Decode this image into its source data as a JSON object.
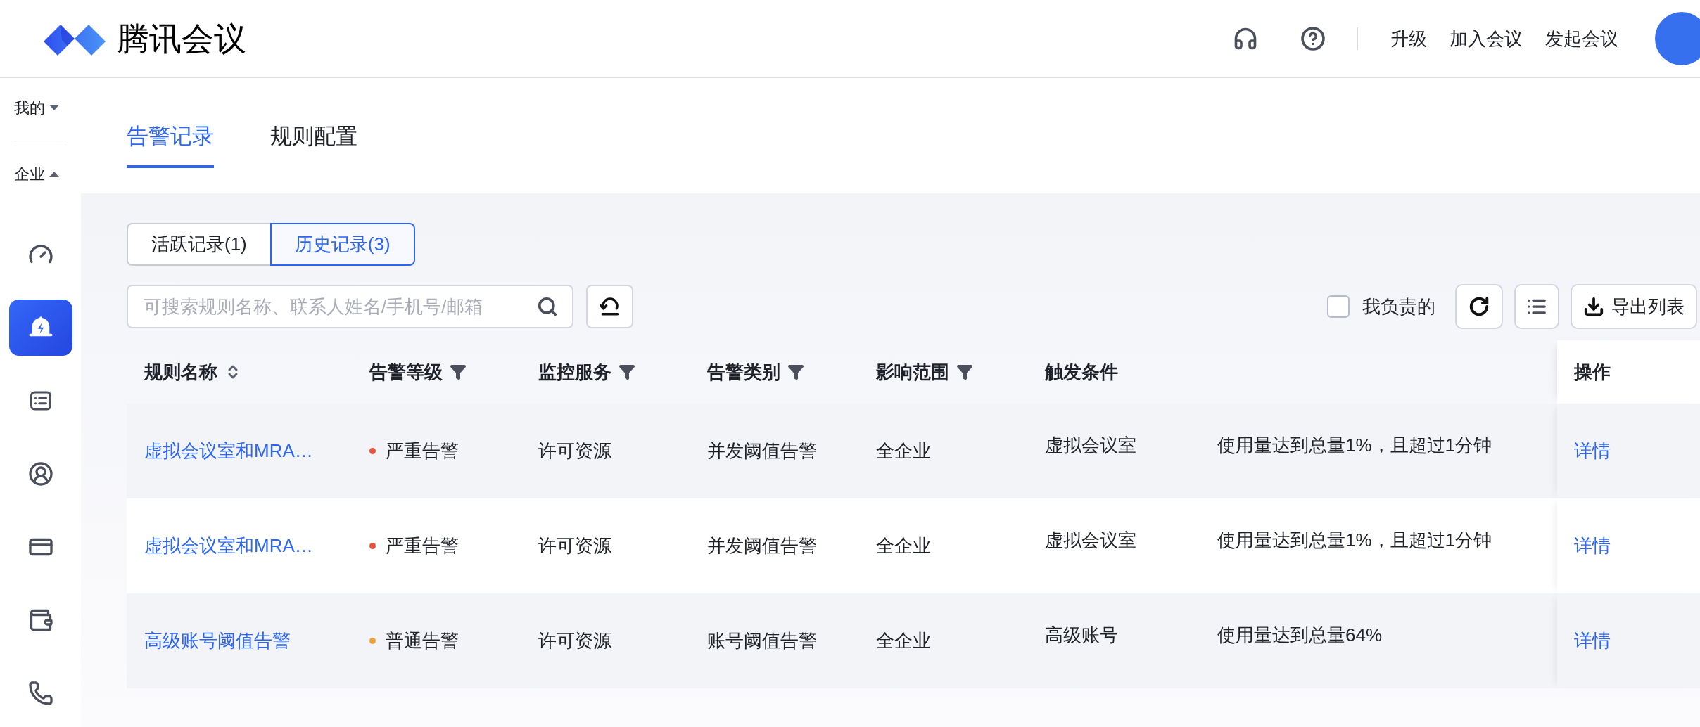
{
  "header": {
    "app_name": "腾讯会议",
    "actions": [
      "升级",
      "加入会议",
      "发起会议"
    ]
  },
  "sidebar": {
    "sections": [
      {
        "label": "我的",
        "expanded": false
      },
      {
        "label": "企业",
        "expanded": true
      }
    ],
    "nav": [
      {
        "kind": "gauge",
        "selected": false
      },
      {
        "kind": "alert",
        "selected": true
      },
      {
        "kind": "list",
        "selected": false
      },
      {
        "kind": "user",
        "selected": false
      },
      {
        "kind": "card",
        "selected": false
      },
      {
        "kind": "wallet",
        "selected": false
      },
      {
        "kind": "phone",
        "selected": false
      }
    ]
  },
  "tabs": [
    {
      "label": "告警记录",
      "selected": true
    },
    {
      "label": "规则配置",
      "selected": false
    }
  ],
  "segments": [
    {
      "label": "活跃记录(1)",
      "selected": false
    },
    {
      "label": "历史记录(3)",
      "selected": true
    }
  ],
  "search": {
    "placeholder": "可搜索规则名称、联系人姓名/手机号/邮箱"
  },
  "mine_filter": {
    "label": "我负责的",
    "checked": false
  },
  "export_button": "导出列表",
  "table": {
    "columns": [
      {
        "label": "规则名称",
        "kind": "sort"
      },
      {
        "label": "告警等级",
        "kind": "filter"
      },
      {
        "label": "监控服务",
        "kind": "filter"
      },
      {
        "label": "告警类别",
        "kind": "filter"
      },
      {
        "label": "影响范围",
        "kind": "filter"
      },
      {
        "label": "触发条件",
        "kind": "plain"
      },
      {
        "label": "操作",
        "kind": "plain"
      }
    ],
    "rows": [
      {
        "name": "虚拟会议室和MRA…",
        "level": {
          "label": "严重告警",
          "color": "#e8533f"
        },
        "service": "许可资源",
        "category": "并发阈值告警",
        "scope": "全企业",
        "trigger_object": "虚拟会议室",
        "trigger_condition": "使用量达到总量1%，且超过1分钟",
        "action": "详情"
      },
      {
        "name": "虚拟会议室和MRA…",
        "level": {
          "label": "严重告警",
          "color": "#e8533f"
        },
        "service": "许可资源",
        "category": "并发阈值告警",
        "scope": "全企业",
        "trigger_object": "虚拟会议室",
        "trigger_condition": "使用量达到总量1%，且超过1分钟",
        "action": "详情"
      },
      {
        "name": "高级账号阈值告警",
        "level": {
          "label": "普通告警",
          "color": "#f0a03a"
        },
        "service": "许可资源",
        "category": "账号阈值告警",
        "scope": "全企业",
        "trigger_object": "高级账号",
        "trigger_condition": "使用量达到总量64%",
        "action": "详情"
      }
    ]
  }
}
